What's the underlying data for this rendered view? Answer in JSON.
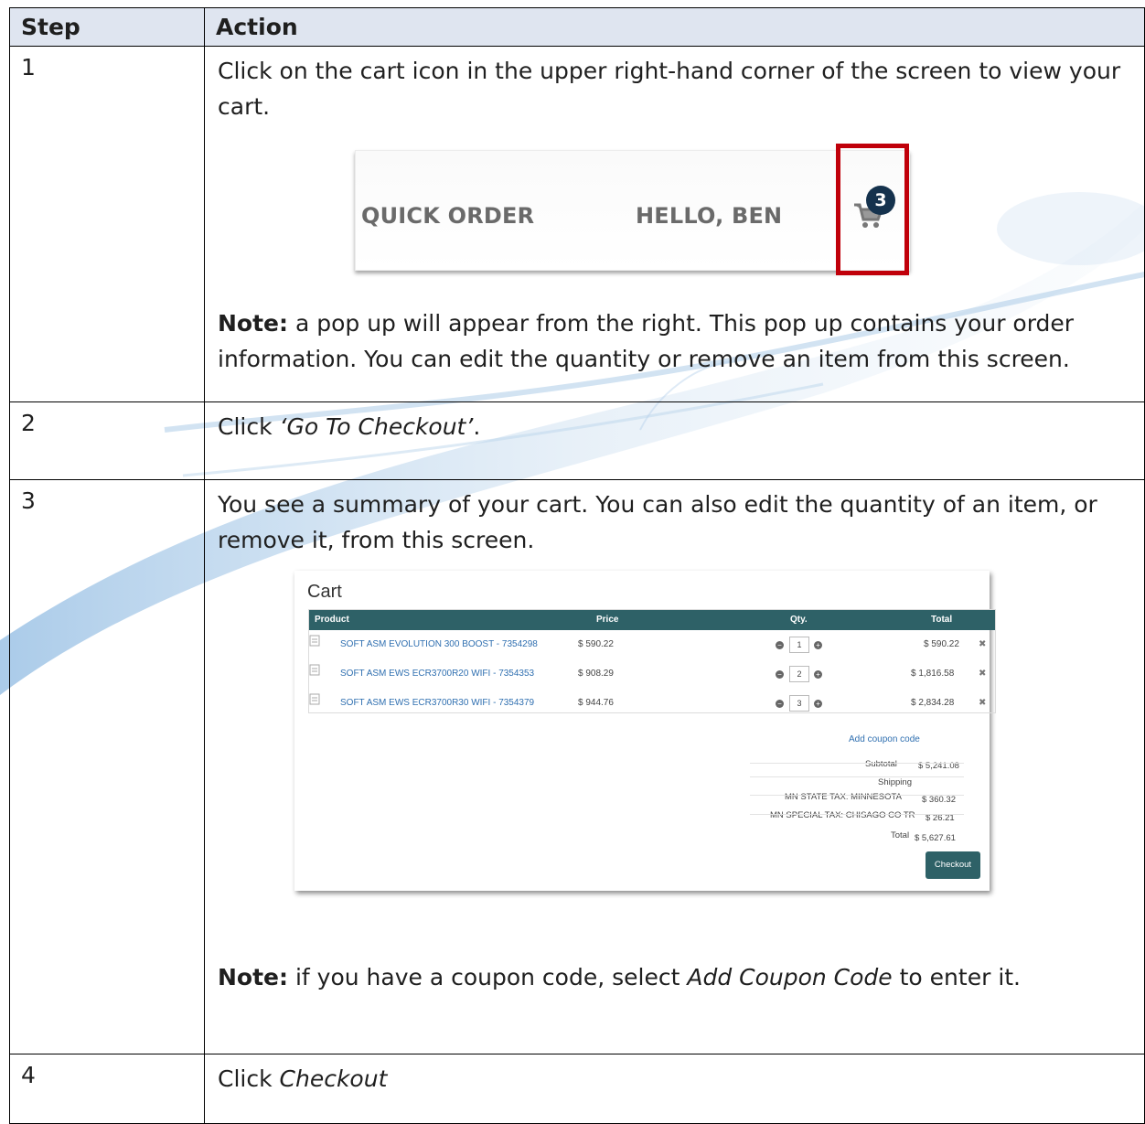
{
  "table": {
    "header_step": "Step",
    "header_action": "Action",
    "rows": [
      {
        "step": "1",
        "text": "Click on the cart icon in the upper right-hand corner of the screen to view your cart.",
        "note_label": "Note:",
        "note_text": " a pop up will appear from the right. This pop up contains your order information. You can edit the quantity or remove an item from this screen."
      },
      {
        "step": "2",
        "text_prefix": "Click ",
        "text_italic": "‘Go To Checkout’",
        "text_suffix": "."
      },
      {
        "step": "3",
        "text": "You see a summary of your cart. You can also edit the quantity of an item, or remove it, from this screen.",
        "note_label": "Note:",
        "note_prefix": " if you have a coupon code, select ",
        "note_italic": "Add Coupon Code",
        "note_suffix": " to enter it."
      },
      {
        "step": "4",
        "text_prefix": "Click ",
        "text_italic": "Checkout"
      }
    ]
  },
  "header_screenshot": {
    "quick_order": "QUICK ORDER",
    "greeting": "HELLO, BEN",
    "cart_count": "3",
    "highlight_color": "#c0000a"
  },
  "cart_screenshot": {
    "title": "Cart",
    "columns": [
      "Product",
      "Price",
      "Qty.",
      "Total"
    ],
    "items": [
      {
        "product": "SOFT ASM EVOLUTION 300 BOOST - 7354298",
        "price": "$ 590.22",
        "qty": "1",
        "total": "$ 590.22"
      },
      {
        "product": "SOFT ASM EWS ECR3700R20 WIFI - 7354353",
        "price": "$ 908.29",
        "qty": "2",
        "total": "$ 1,816.58"
      },
      {
        "product": "SOFT ASM EWS ECR3700R30 WIFI - 7354379",
        "price": "$ 944.76",
        "qty": "3",
        "total": "$ 2,834.28"
      }
    ],
    "add_coupon": "Add coupon code",
    "subtotal_label": "Subtotal",
    "subtotal_value": "$ 5,241.08",
    "shipping_label": "Shipping",
    "tax1_label": "MN STATE TAX: MINNESOTA",
    "tax1_value": "$ 360.32",
    "tax2_label": "MN SPECIAL TAX: CHISAGO CO TR",
    "tax2_value": "$ 26.21",
    "total_label": "Total",
    "total_value": "$ 5,627.61",
    "checkout_label": "Checkout",
    "header_color": "#2e6167",
    "link_color": "#2f6fb0"
  }
}
